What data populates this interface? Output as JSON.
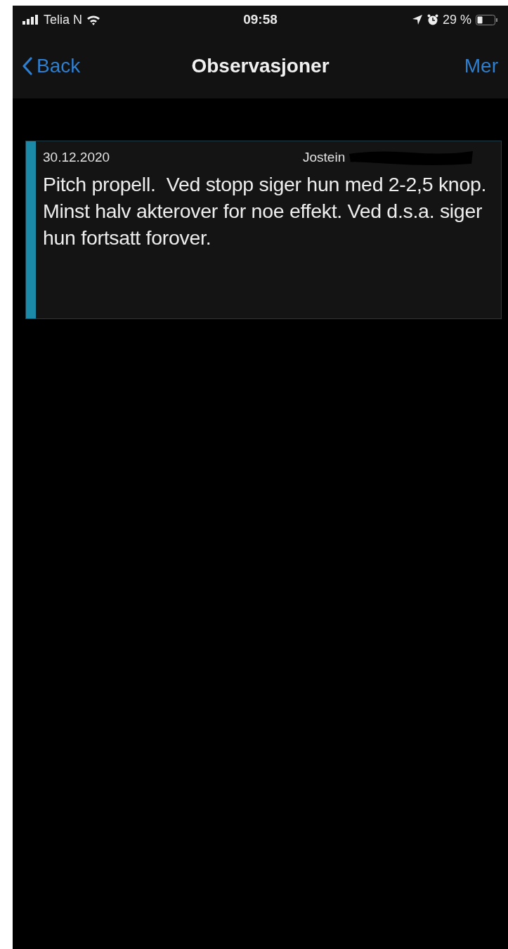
{
  "status_bar": {
    "carrier": "Telia N",
    "time": "09:58",
    "battery": "29 %"
  },
  "nav_bar": {
    "back": "Back",
    "title": "Observasjoner",
    "action": "Mer"
  },
  "observations": [
    {
      "date": "30.12.2020",
      "author": "Jostein",
      "text": "Pitch propell.  Ved stopp siger hun med 2-2,5 knop.  Minst halv akterover for noe effekt. Ved d.s.a. siger hun fortsatt forover."
    }
  ]
}
